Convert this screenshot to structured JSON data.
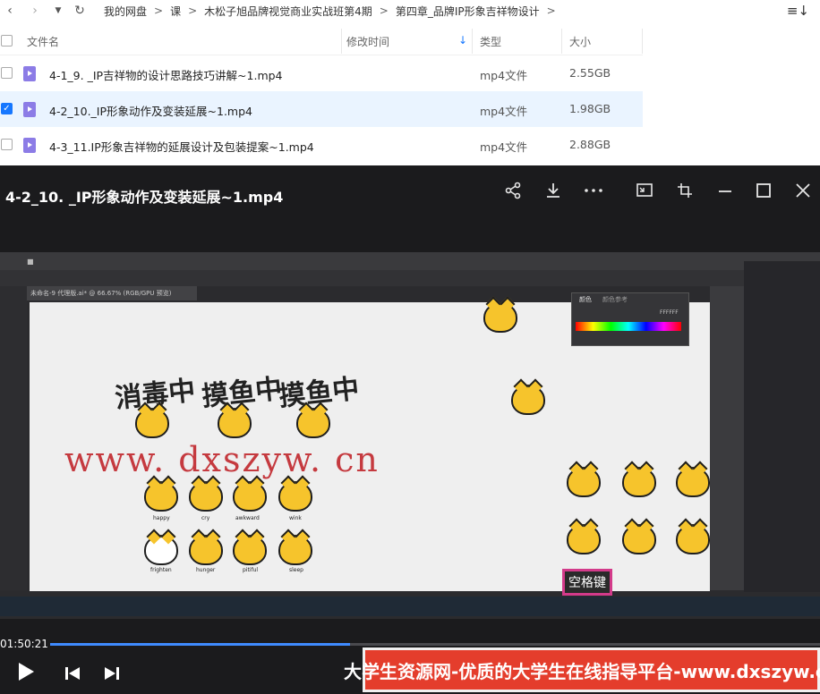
{
  "toolbar": {
    "back_icon": "chevron-left-icon",
    "forward_icon": "chevron-right-icon",
    "dropdown_icon": "caret-down-icon",
    "refresh_icon": "refresh-icon",
    "sort_icon": "sort-list-icon"
  },
  "breadcrumb": [
    "我的网盘",
    "课",
    "木松子旭品牌视觉商业实战班第4期",
    "第四章_品牌IP形象吉祥物设计"
  ],
  "columns": {
    "name": "文件名",
    "modified": "修改时间",
    "type": "类型",
    "size": "大小"
  },
  "files": [
    {
      "name": "4-1_9. _IP吉祥物的设计思路技巧讲解~1.mp4",
      "type": "mp4文件",
      "size": "2.55GB",
      "selected": false
    },
    {
      "name": "4-2_10._IP形象动作及变装延展~1.mp4",
      "type": "mp4文件",
      "size": "1.98GB",
      "selected": true
    },
    {
      "name": "4-3_11.IP形象吉祥物的延展设计及包装提案~1.mp4",
      "type": "mp4文件",
      "size": "2.88GB",
      "selected": false
    }
  ],
  "player": {
    "title": "4-2_10. _IP形象动作及变装延展~1.mp4",
    "icons": [
      "share-icon",
      "download-icon",
      "more-icon",
      "picture-in-picture-icon",
      "crop-icon",
      "minimize-icon",
      "maximize-icon",
      "close-icon"
    ],
    "current_time": "01:50:21",
    "progress": 0.39,
    "controls": [
      "play-icon",
      "previous-icon",
      "next-icon"
    ]
  },
  "video": {
    "watermark": "www. dxszyw. cn",
    "tab_title": "未命名-9 代理版.ai* @ 66.67% (RGB/GPU 预览)",
    "sticker_labels": [
      "消毒中",
      "摸鱼中",
      "摸鱼中"
    ],
    "cat_labels": [
      "happy",
      "cry",
      "awkward",
      "wink",
      "frighten",
      "hunger",
      "pitiful",
      "sleep"
    ],
    "key_label": "空格键",
    "color_panel_hex": "FFFFFF",
    "color_panel_tabs": [
      "颜色",
      "颜色参考"
    ]
  },
  "banner": {
    "text": "大学生资源网-优质的大学生在线指导平台-www.dxszyw.cn"
  },
  "colors": {
    "accent": "#1677ff",
    "banner_bg": "#e43d2c",
    "selected_row": "#eaf4ff",
    "player_bg": "#1b1b1d"
  }
}
